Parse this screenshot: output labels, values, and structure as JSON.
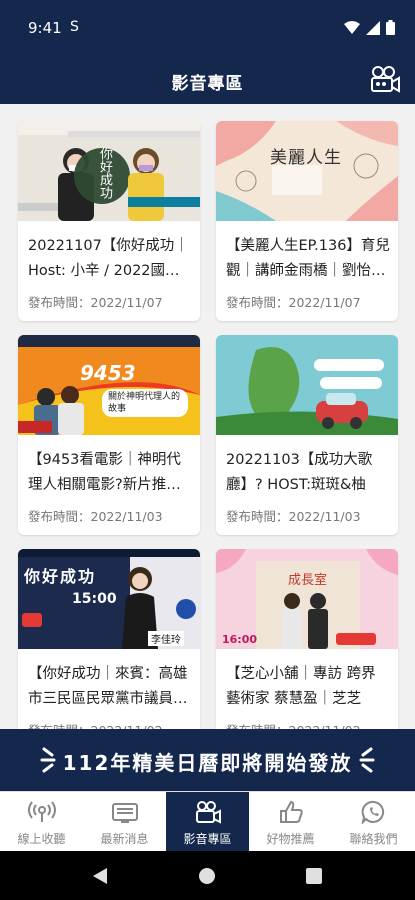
{
  "status_bar": {
    "time": "9:41",
    "extra": "S"
  },
  "app_bar": {
    "title": "影音專區"
  },
  "cards": [
    {
      "title": "20221107【你好成功｜Host: 小辛 / 2022國…",
      "date": "發布時間：2022/11/07",
      "thumb_text": "你好成功"
    },
    {
      "title": "【美麗人生EP.136】育兒觀｜講師金雨橋｜劉怡…",
      "date": "發布時間：2022/11/07",
      "thumb_text": "美麗人生"
    },
    {
      "title": "【9453看電影｜神明代理人相關電影?新片推…",
      "date": "發布時間：2022/11/03",
      "thumb_text": "9453",
      "thumb_sub": "關於神明代理人的故事"
    },
    {
      "title": "20221103【成功大歌廳】? HOST:斑斑&柚子…",
      "date": "發布時間：2022/11/03",
      "thumb_text": ""
    },
    {
      "title": "【你好成功｜來賓：高雄市三民區民眾黨市議員…",
      "date": "發布時間：2022/11/02",
      "thumb_text": "你好成功",
      "thumb_sub": "15:00",
      "thumb_name": "李佳玲"
    },
    {
      "title": "【芝心小舖｜專訪 跨界藝術家 蔡慧盈｜芝芝主…",
      "date": "發布時間：2022/11/02",
      "thumb_text": "成長室",
      "thumb_sub": "16:00"
    }
  ],
  "banner": {
    "text": "112年精美日曆即將開始發放"
  },
  "nav": [
    {
      "label": "線上收聽",
      "icon": "radio-wave-icon"
    },
    {
      "label": "最新消息",
      "icon": "news-tv-icon"
    },
    {
      "label": "影音專區",
      "icon": "video-camera-icon"
    },
    {
      "label": "好物推薦",
      "icon": "thumbs-up-icon"
    },
    {
      "label": "聯絡我們",
      "icon": "phone-chat-icon"
    }
  ],
  "colors": {
    "primary": "#14284d",
    "background": "#f1f1f1"
  }
}
